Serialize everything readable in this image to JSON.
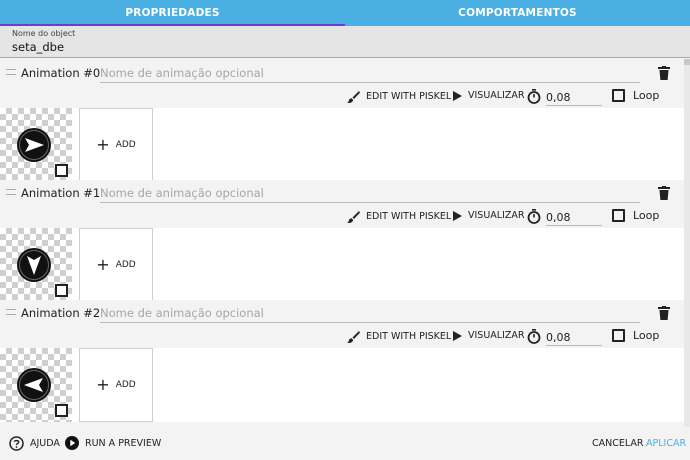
{
  "tabs": [
    {
      "label": "PROPRIEDADES",
      "active": true
    },
    {
      "label": "COMPORTAMENTOS",
      "active": false
    }
  ],
  "object_name": {
    "label": "Nome do object",
    "value": "seta_dbe"
  },
  "animations": [
    {
      "title": "Animation #0",
      "name_placeholder": "Nome de animação opcional",
      "edit_label": "EDIT WITH PISKEL",
      "preview_label": "VISUALIZAR",
      "duration": "0,08",
      "loop_label": "Loop",
      "add_label": "ADD",
      "sprite_icon": "arrow-right-icon"
    },
    {
      "title": "Animation #1",
      "name_placeholder": "Nome de animação opcional",
      "edit_label": "EDIT WITH PISKEL",
      "preview_label": "VISUALIZAR",
      "duration": "0,08",
      "loop_label": "Loop",
      "add_label": "ADD",
      "sprite_icon": "arrow-down-icon"
    },
    {
      "title": "Animation #2",
      "name_placeholder": "Nome de animação opcional",
      "edit_label": "EDIT WITH PISKEL",
      "preview_label": "VISUALIZAR",
      "duration": "0,08",
      "loop_label": "Loop",
      "add_label": "ADD",
      "sprite_icon": "arrow-left-icon"
    }
  ],
  "footer": {
    "help_label": "AJUDA",
    "preview_label": "RUN A PREVIEW",
    "cancel_label": "CANCELAR",
    "apply_label": "APLICAR"
  },
  "colors": {
    "tab_bar": "#4ab0e4",
    "tab_underline": "#6a3fd0",
    "apply": "#4ab0e4"
  }
}
